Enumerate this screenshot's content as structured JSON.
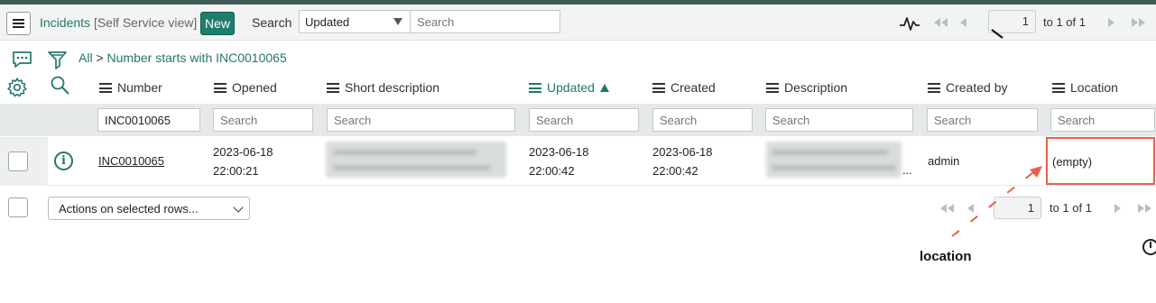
{
  "header": {
    "title": "Incidents",
    "view": "[Self Service view]",
    "new_label": "New",
    "search_label": "Search",
    "search_field_selected": "Updated",
    "search_placeholder": "Search",
    "page_value": "1",
    "page_total_text": "to 1 of 1"
  },
  "breadcrumb": {
    "all": "All",
    "separator": ">",
    "condition": "Number starts with INC0010065"
  },
  "columns": [
    {
      "label": "Number"
    },
    {
      "label": "Opened"
    },
    {
      "label": "Short description"
    },
    {
      "label": "Updated",
      "sorted": "ascending"
    },
    {
      "label": "Created"
    },
    {
      "label": "Description"
    },
    {
      "label": "Created by"
    },
    {
      "label": "Location"
    }
  ],
  "filters": {
    "number": "INC0010065",
    "placeholder": "Search"
  },
  "row": {
    "number": "INC0010065",
    "opened_date": "2023-06-18",
    "opened_time": "22:00:21",
    "updated_date": "2023-06-18",
    "updated_time": "22:00:42",
    "created_date": "2023-06-18",
    "created_time": "22:00:42",
    "description_ellipsis": "...",
    "created_by": "admin",
    "location": "(empty)"
  },
  "footer": {
    "actions_label": "Actions on selected rows...",
    "page_value": "1",
    "page_total_text": "to 1 of 1"
  },
  "annotation": {
    "label": "location",
    "color": "#e8604a"
  },
  "colors": {
    "accent": "#23776d",
    "new_button": "#1f7d6f",
    "highlight": "#e8604a"
  }
}
